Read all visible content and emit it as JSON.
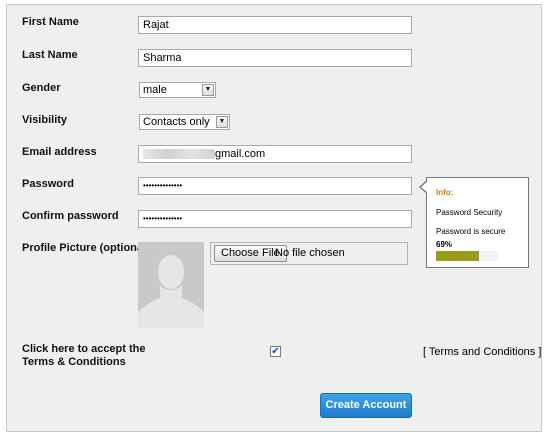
{
  "form": {
    "first_name": {
      "label": "First Name",
      "value": "Rajat"
    },
    "last_name": {
      "label": "Last Name",
      "value": "Sharma"
    },
    "gender": {
      "label": "Gender",
      "value": "male"
    },
    "visibility": {
      "label": "Visibility",
      "value": "Contacts only"
    },
    "email": {
      "label": "Email address",
      "value": "gmail.com"
    },
    "password": {
      "label": "Password",
      "value": "••••••••••••••"
    },
    "confirm_password": {
      "label": "Confirm password",
      "value": "••••••••••••••"
    },
    "profile_picture": {
      "label": "Profile Picture (optional)",
      "button": "Choose File",
      "status": "No file chosen"
    },
    "accept": {
      "label_line1": "Click here to accept the",
      "label_line2": "Terms & Conditions",
      "checked": true,
      "check_glyph": "✔"
    },
    "terms_link": "[ Terms and Conditions ]",
    "submit": "Create Account"
  },
  "password_info": {
    "title": "Info:",
    "heading": "Password Security",
    "status": "Password is secure",
    "strength_text": "69%",
    "strength": 0.69,
    "title_color": "#e07a1f",
    "bar_color": "#9a9a1c"
  }
}
